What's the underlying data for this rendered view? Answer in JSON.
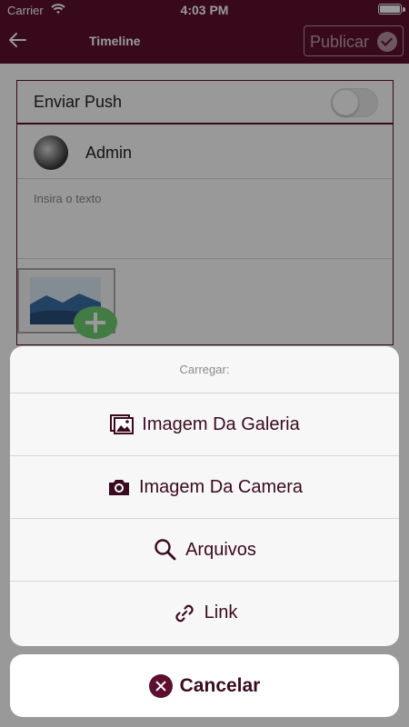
{
  "status_bar": {
    "carrier": "Carrier",
    "time": "4:03 PM",
    "wifi_icon": "wifi-icon",
    "battery_icon": "battery-icon"
  },
  "nav": {
    "back_icon": "arrow-left-icon",
    "title": "Timeline",
    "publish_label": "Publicar",
    "publish_icon": "check-circle-icon"
  },
  "form": {
    "push_label": "Enviar Push",
    "push_enabled": false,
    "user_name": "Admin",
    "text_placeholder": "Insira o texto",
    "add_image_icon": "image-add-icon"
  },
  "action_sheet": {
    "title": "Carregar:",
    "options": [
      {
        "label": "Imagem Da Galeria",
        "icon": "gallery-icon"
      },
      {
        "label": "Imagem Da Camera",
        "icon": "camera-icon"
      },
      {
        "label": "Arquivos",
        "icon": "search-icon"
      },
      {
        "label": "Link",
        "icon": "link-icon"
      }
    ],
    "cancel_label": "Cancelar",
    "cancel_icon": "close-circle-icon"
  },
  "colors": {
    "brand": "#5c0f2e",
    "sheet_text": "#3a0a1e",
    "accent_green": "#6fcf72"
  }
}
